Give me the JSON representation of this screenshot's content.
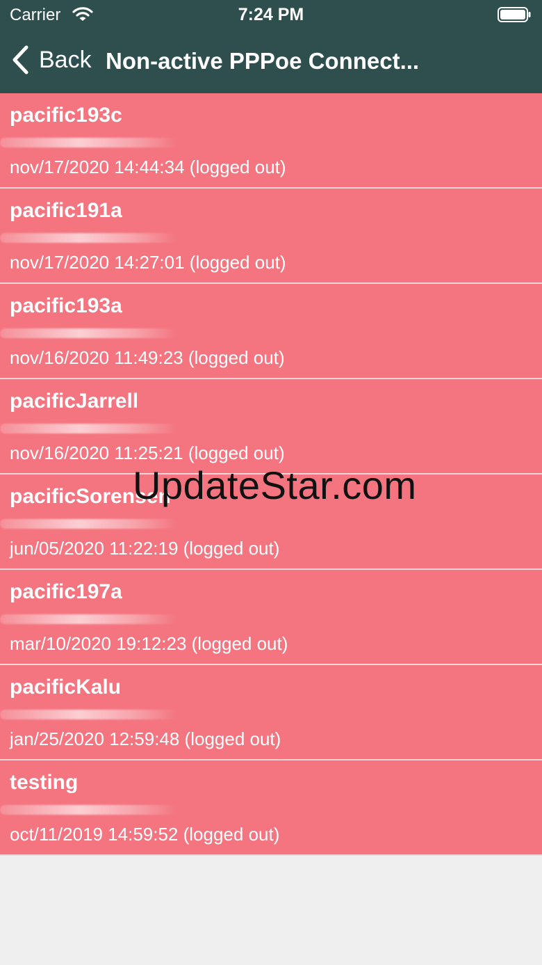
{
  "status_bar": {
    "carrier": "Carrier",
    "time": "7:24 PM",
    "wifi_icon": "wifi-icon",
    "battery_icon": "battery-icon"
  },
  "nav": {
    "back_label": "Back",
    "back_icon": "chevron-left-icon",
    "title": "Non-active PPPoe Connect..."
  },
  "colors": {
    "header_bg": "#2f4f4f",
    "row_bg": "#f47580",
    "row_separator": "#f9d4d8",
    "page_bg": "#efefef"
  },
  "connections": [
    {
      "name": "pacific193c",
      "time": "nov/17/2020 14:44:34 (logged out)"
    },
    {
      "name": "pacific191a",
      "time": "nov/17/2020 14:27:01 (logged out)"
    },
    {
      "name": "pacific193a",
      "time": "nov/16/2020 11:49:23 (logged out)"
    },
    {
      "name": "pacificJarrell",
      "time": "nov/16/2020 11:25:21 (logged out)"
    },
    {
      "name": "pacificSorensen",
      "time": "jun/05/2020 11:22:19 (logged out)"
    },
    {
      "name": "pacific197a",
      "time": "mar/10/2020 19:12:23 (logged out)"
    },
    {
      "name": "pacificKalu",
      "time": "jan/25/2020 12:59:48 (logged out)"
    },
    {
      "name": "testing",
      "time": "oct/11/2019 14:59:52 (logged out)"
    }
  ],
  "watermark": "UpdateStar.com"
}
